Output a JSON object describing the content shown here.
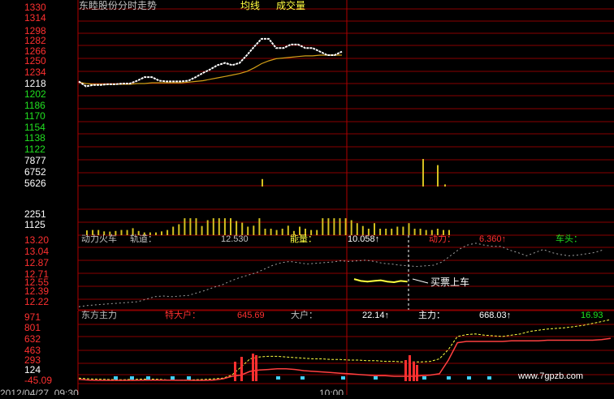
{
  "watermark": "www.7gpzb.com",
  "colors": {
    "background": "#000000",
    "grid": "#8a0000",
    "frame": "#b00000",
    "price_line": "#ffffff",
    "avg_line": "#d4a017",
    "volume": "#d4c020",
    "up_label": "#ff3030",
    "down_label": "#20e020",
    "white": "#ffffff",
    "dim": "#a0a0a0"
  },
  "time_axis": [
    "2012/04/27, 09:30",
    "10:00"
  ],
  "chart_data": [
    {
      "type": "line",
      "title": "东睦股份分时走势",
      "legend": [
        "均线",
        "成交量"
      ],
      "y_ticks_up": [
        "1330",
        "1314",
        "1298",
        "1282",
        "1266",
        "1250",
        "1234",
        "1218"
      ],
      "y_ticks_down": [
        "1202",
        "1186",
        "1170",
        "1154",
        "1138",
        "1122"
      ],
      "yref": 12.18,
      "ylim": [
        11.22,
        13.3
      ],
      "series": [
        {
          "name": "价格",
          "values": [
            12.21,
            12.14,
            12.16,
            12.16,
            12.17,
            12.17,
            12.18,
            12.18,
            12.22,
            12.27,
            12.27,
            12.22,
            12.21,
            12.21,
            12.21,
            12.22,
            12.27,
            12.33,
            12.38,
            12.44,
            12.47,
            12.44,
            12.47,
            12.58,
            12.7,
            12.81,
            12.81,
            12.68,
            12.68,
            12.73,
            12.73,
            12.68,
            12.68,
            12.63,
            12.58,
            12.58,
            12.63
          ]
        },
        {
          "name": "均线",
          "values": [
            12.2,
            12.18,
            12.17,
            12.17,
            12.17,
            12.17,
            12.17,
            12.17,
            12.18,
            12.18,
            12.19,
            12.19,
            12.19,
            12.19,
            12.19,
            12.2,
            12.21,
            12.22,
            12.24,
            12.26,
            12.28,
            12.3,
            12.32,
            12.35,
            12.4,
            12.46,
            12.5,
            12.53,
            12.54,
            12.55,
            12.56,
            12.57,
            12.57,
            12.58,
            12.58,
            12.58,
            12.58
          ]
        }
      ]
    },
    {
      "type": "bar",
      "title": "成交量",
      "y_ticks": [
        "7877",
        "6752",
        "5626"
      ],
      "values_at_slot": [
        {
          "slot": 25,
          "value": 6000
        },
        {
          "slot": 47,
          "value": 7877
        },
        {
          "slot": 49,
          "value": 7300
        },
        {
          "slot": 50,
          "value": 5500
        }
      ]
    },
    {
      "type": "bar",
      "y_ticks": [
        "2251",
        "1125"
      ],
      "ylim": [
        0,
        2600
      ],
      "values": [
        480,
        520,
        520,
        380,
        360,
        420,
        520,
        520,
        700,
        420,
        280,
        280,
        280,
        380,
        520,
        850,
        1100,
        1700,
        1700,
        1700,
        920,
        1500,
        1700,
        1700,
        1700,
        1700,
        1420,
        1250,
        850,
        950,
        1700,
        650,
        650,
        520,
        650,
        950,
        420,
        850,
        650,
        520,
        520,
        1700,
        1700,
        1700,
        1700,
        1700,
        1500,
        1200,
        920,
        650,
        1200,
        650,
        650,
        650,
        850,
        850,
        1200,
        650,
        650,
        520,
        520,
        650,
        520,
        520
      ]
    },
    {
      "type": "line",
      "title": "动力火车",
      "labels": {
        "track": "轨道：",
        "track_value": "12.530",
        "energy": "能量：",
        "energy_value": "10.058↑",
        "power": "动力：",
        "power_value": "6.360↑",
        "head": "车头："
      },
      "annotation": "买票上车",
      "y_ticks": [
        "13.20",
        "13.04",
        "12.87",
        "12.71",
        "12.55",
        "12.39",
        "12.22"
      ],
      "ylim": [
        12.14,
        13.2
      ],
      "series": [
        {
          "name": "轨道",
          "values": [
            12.14,
            12.16,
            12.17,
            12.18,
            12.19,
            12.2,
            12.21,
            12.22,
            12.26,
            12.3,
            12.31,
            12.3,
            12.31,
            12.32,
            12.36,
            12.4,
            12.45,
            12.49,
            12.55,
            12.6,
            12.64,
            12.68,
            12.74,
            12.8,
            12.84,
            12.86,
            12.84,
            12.82,
            12.83,
            12.84,
            12.85,
            12.87,
            12.86,
            12.87,
            12.88,
            12.86,
            12.83,
            12.82,
            12.8,
            12.79,
            12.78,
            12.79,
            12.8,
            12.85,
            12.95,
            13.05,
            13.12,
            13.15,
            13.12,
            13.1,
            13.1,
            13.04,
            13.0,
            12.95,
            13.0,
            13.05,
            13.0,
            12.97,
            12.95,
            12.96,
            12.98,
            13.0,
            13.04
          ]
        },
        {
          "name": "能量",
          "values": [
            12.58,
            12.55,
            12.54,
            12.55,
            12.56,
            12.54,
            12.53,
            12.55,
            12.54
          ]
        }
      ]
    },
    {
      "type": "line",
      "title": "东方主力",
      "labels": {
        "big_special": "特大户：",
        "big_special_value": "645.69",
        "big": "大户：",
        "big_value": "22.14↑",
        "main": "主力：",
        "main_value": "668.03↑",
        "last_value": "16.93"
      },
      "y_ticks": [
        "971",
        "801",
        "632",
        "463",
        "293",
        "124",
        "-45.09"
      ],
      "ylim": [
        -45.09,
        971
      ],
      "series": [
        {
          "name": "主力",
          "values": [
            -10,
            -20,
            -25,
            -30,
            -35,
            -35,
            -30,
            -25,
            -25,
            -30,
            -40,
            -45,
            -40,
            -35,
            -30,
            -20,
            -10,
            40,
            170,
            300,
            330,
            340,
            340,
            330,
            320,
            310,
            300,
            300,
            290,
            290,
            280,
            280,
            270,
            270,
            260,
            260,
            250,
            250,
            250,
            260,
            300,
            450,
            660,
            690,
            700,
            680,
            670,
            660,
            680,
            700,
            740,
            760,
            780,
            790,
            800,
            820,
            840,
            870,
            900,
            930
          ]
        },
        {
          "name": "特大户",
          "values": [
            -30,
            -40,
            -45,
            -45,
            -45,
            -45,
            -45,
            -44,
            -43,
            -42,
            -43,
            -44,
            -44,
            -45,
            -45,
            -40,
            -20,
            20,
            40,
            100,
            120,
            130,
            140,
            140,
            130,
            110,
            100,
            90,
            80,
            70,
            60,
            50,
            40,
            30,
            30,
            20,
            20,
            20,
            30,
            40,
            60,
            280,
            560,
            580,
            580,
            580,
            580,
            580,
            590,
            590,
            590,
            590,
            600,
            600,
            600,
            600,
            600,
            600,
            610,
            630
          ]
        }
      ]
    }
  ]
}
